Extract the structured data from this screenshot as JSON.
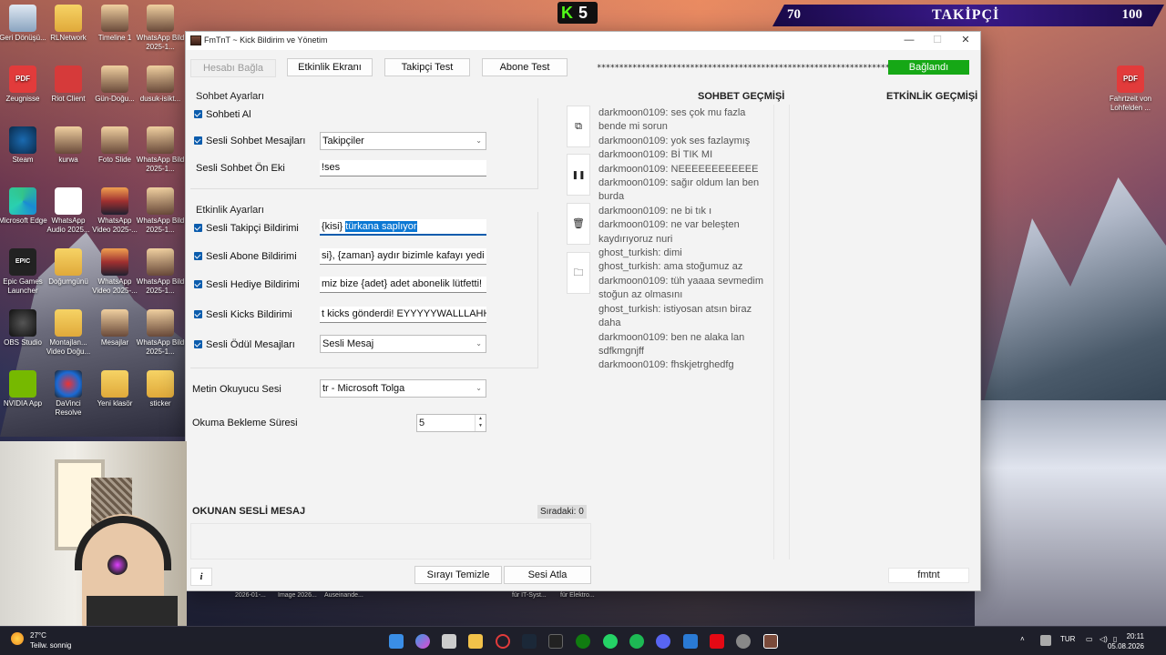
{
  "overlay": {
    "kick_logo": "K",
    "kick_count": "5",
    "follower_current": "70",
    "follower_label": "TAKİPÇİ",
    "follower_goal": "100"
  },
  "desktop_icons": [
    {
      "label": "Geri Dönüşü...",
      "icon": "recycle-bin-icon"
    },
    {
      "label": "RLNetwork",
      "icon": "folder-icon"
    },
    {
      "label": "Timeline 1",
      "icon": "image-file-icon"
    },
    {
      "label": "WhatsApp Bild 2025-1...",
      "icon": "image-file-icon"
    },
    {
      "label": "Zeugnisse",
      "icon": "pdf-icon"
    },
    {
      "label": "Riot Client",
      "icon": "riot-client-icon"
    },
    {
      "label": "Gün-Doğu...",
      "icon": "image-file-icon"
    },
    {
      "label": "dusuk-isikt...",
      "icon": "image-file-icon"
    },
    {
      "label": "Steam",
      "icon": "steam-icon"
    },
    {
      "label": "kurwa",
      "icon": "image-file-icon"
    },
    {
      "label": "Foto Slide",
      "icon": "image-file-icon"
    },
    {
      "label": "WhatsApp Bild 2025-1...",
      "icon": "image-file-icon"
    },
    {
      "label": "Microsoft Edge",
      "icon": "edge-icon"
    },
    {
      "label": "WhatsApp Audio 2025...",
      "icon": "media-file-icon"
    },
    {
      "label": "WhatsApp Video 2025-...",
      "icon": "video-file-icon"
    },
    {
      "label": "WhatsApp Bild 2025-1...",
      "icon": "image-file-icon"
    },
    {
      "label": "Epic Games Launcher",
      "icon": "epic-games-icon"
    },
    {
      "label": "Doğumgünü",
      "icon": "folder-icon"
    },
    {
      "label": "WhatsApp Video 2025-...",
      "icon": "video-file-icon"
    },
    {
      "label": "WhatsApp Bild 2025-1...",
      "icon": "image-file-icon"
    },
    {
      "label": "OBS Studio",
      "icon": "obs-icon"
    },
    {
      "label": "Montajlan... Video Doğu...",
      "icon": "folder-icon"
    },
    {
      "label": "Mesajlar",
      "icon": "image-file-icon"
    },
    {
      "label": "WhatsApp Bild 2025-1...",
      "icon": "image-file-icon"
    },
    {
      "label": "NVIDIA App",
      "icon": "nvidia-icon"
    },
    {
      "label": "DaVinci Resolve",
      "icon": "davinci-icon"
    },
    {
      "label": "Yeni klasör",
      "icon": "folder-icon"
    },
    {
      "label": "sticker",
      "icon": "folder-icon"
    },
    {
      "label": "Fahrtzeit von Lohfelden ...",
      "icon": "pdf-icon"
    }
  ],
  "window": {
    "title": "FmTnT ~ Kick Bildirim ve Yönetim",
    "min_glyph": "—",
    "max_glyph": "☐",
    "close_glyph": "✕"
  },
  "toolbar": {
    "connect_account": "Hesabı Bağla",
    "event_screen": "Etkinlik Ekranı",
    "follower_test": "Takipçi Test",
    "subscriber_test": "Abone Test",
    "masked_key": "****************************************************************************************************",
    "status": "Bağlandı"
  },
  "chat_settings": {
    "section_title": "Sohbet Ayarları",
    "receive_chat_label": "Sohbeti Al",
    "voice_chat_label": "Sesli Sohbet Mesajları",
    "voice_chat_value": "Takipçiler",
    "voice_prefix_label": "Sesli Sohbet Ön Eki",
    "voice_prefix_value": "!ses"
  },
  "event_settings": {
    "section_title": "Etkinlik Ayarları",
    "follower_label": "Sesli Takipçi Bildirimi",
    "follower_value_plain": "{kisi} ",
    "follower_value_selected": "türkana saplıyor",
    "subscriber_label": "Sesli Abone Bildirimi",
    "subscriber_value": "si}, {zaman} aydır bizimle kafayı yedi",
    "gift_label": "Sesli Hediye Bildirimi",
    "gift_value": "miz bize {adet} adet abonelik lütfetti!",
    "kicks_label": "Sesli Kicks Bildirimi",
    "kicks_value": "t kicks gönderdi! EYYYYYWALLLAHHH",
    "reward_label": "Sesli Ödül Mesajları",
    "reward_value": "Sesli Mesaj"
  },
  "tts": {
    "voice_label": "Metin Okuyucu Sesi",
    "voice_value": "tr - Microsoft Tolga",
    "delay_label": "Okuma Bekleme Süresi",
    "delay_value": "5"
  },
  "side_buttons": {
    "snapshot_glyph": "⧉",
    "pause_glyph": "❚❚",
    "clear_glyph": "🗑",
    "folder_glyph": "🗀"
  },
  "chat_history": {
    "title": "SOHBET GEÇMİŞİ",
    "lines": [
      "darkmoon0109: ses çok mu fazla",
      "bende mi sorun",
      "darkmoon0109: yok ses fazlaymış",
      "darkmoon0109: Bİ TIK MI",
      "darkmoon0109: NEEEEEEEEEEEE",
      "darkmoon0109: sağır oldum lan ben",
      "burda",
      "darkmoon0109: ne bi tık ı",
      "darkmoon0109: ne var beleşten",
      "kaydırıyoruz nuri",
      "ghost_turkish: dimi",
      "ghost_turkish: ama stoğumuz az",
      "darkmoon0109: tüh yaaaa sevmedim",
      "stoğun az olmasını",
      "ghost_turkish: istiyosan atsın biraz",
      "daha",
      "darkmoon0109: ben ne alaka lan",
      "sdfkmgnjff",
      "darkmoon0109: fhskjetrghedfg"
    ]
  },
  "event_history": {
    "title": "ETKİNLİK GEÇMİŞİ"
  },
  "queue": {
    "label": "OKUNAN SESLİ MESAJ",
    "count": "Sıradaki: 0",
    "clear_button": "Sırayı Temizle",
    "skip_button": "Sesi Atla",
    "info_glyph": "i",
    "footer": "fmtnt"
  },
  "background_files": [
    "2026-01-...",
    "Image 2026...",
    "Auseinande...",
    "für IT-Syst...",
    "für Elektro..."
  ],
  "taskbar": {
    "weather_temp": "27°C",
    "weather_desc": "Teilw. sonnig",
    "language": "TUR",
    "time": "20:11",
    "date": "05.08.2026"
  }
}
